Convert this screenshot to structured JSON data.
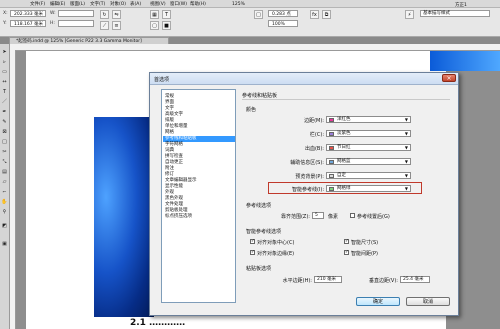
{
  "menubar": {
    "items": [
      "文件(F)",
      "编辑(E)",
      "版面(L)",
      "文字(T)",
      "对象(O)",
      "表(A)",
      "视图(V)",
      "窗口(W)",
      "帮助(H)"
    ]
  },
  "control": {
    "x_label": "X:",
    "x_value": "202.333 毫米",
    "y_label": "Y:",
    "y_value": "118.167 毫米",
    "w_label": "W:",
    "h_label": "H:",
    "zoom": "125%",
    "stroke_value": "0.283 点",
    "stroke_pct": "100%",
    "workspace": "方正1",
    "search_placeholder": "基本描写样式"
  },
  "document_tab": "*起签码.indd @ 125% [Generic P22 3.3 Gamma Monitor]",
  "page_heading": "2.1 …………",
  "dialog": {
    "title": "首选项",
    "close_glyph": "×",
    "categories": [
      "常规",
      "界面",
      "文字",
      "高级文字",
      "排版",
      "单位和增量",
      "网格",
      "参考线和粘贴板",
      "字符网格",
      "词典",
      "拼写检查",
      "自动更正",
      "附注",
      "修订",
      "文章编辑器显示",
      "显示性能",
      "外观",
      "黑色外观",
      "文件处理",
      "剪贴板处理",
      "标点挤压选项"
    ],
    "selected_index": 7,
    "panel_title": "参考线和粘贴板",
    "color_section": "颜色",
    "fields": [
      {
        "label": "边距(M):",
        "value": "洋红色",
        "swatch": "#e8379a"
      },
      {
        "label": "栏(C):",
        "value": "淡紫色",
        "swatch": "#9b7fd9"
      },
      {
        "label": "出血(B):",
        "value": "节日红",
        "swatch": "#e6534b"
      },
      {
        "label": "辅助信息区(S):",
        "value": "网格蓝",
        "swatch": "#6fa8dc"
      },
      {
        "label": "预览背景(P):",
        "value": "自定",
        "swatch": "#dcdcdc"
      },
      {
        "label": "智能参考线(I):",
        "value": "网格绿",
        "swatch": "#7fd17f"
      }
    ],
    "guide_options_section": "参考线选项",
    "snap_label": "靠齐范围(Z):",
    "snap_value": "5",
    "snap_unit": "像素",
    "guides_back_label": "参考线置后(G)",
    "smart_section": "智能参考线选项",
    "smart": [
      {
        "label": "对齐对象中心(C)",
        "checked": true
      },
      {
        "label": "智能尺寸(S)",
        "checked": true
      },
      {
        "label": "对齐对象边缘(E)",
        "checked": true
      },
      {
        "label": "智能间距(P)",
        "checked": true
      }
    ],
    "pasteboard_section": "粘贴板选项",
    "horiz_label": "水平边距(H):",
    "horiz_value": "210 毫米",
    "vert_label": "垂直边距(V):",
    "vert_value": "25.4 毫米",
    "ok_label": "确定",
    "cancel_label": "取消",
    "check_glyph": "✓",
    "arrow_glyph": "▼"
  },
  "colors": {
    "highlight": "#c0392b",
    "selection": "#3399ff"
  }
}
